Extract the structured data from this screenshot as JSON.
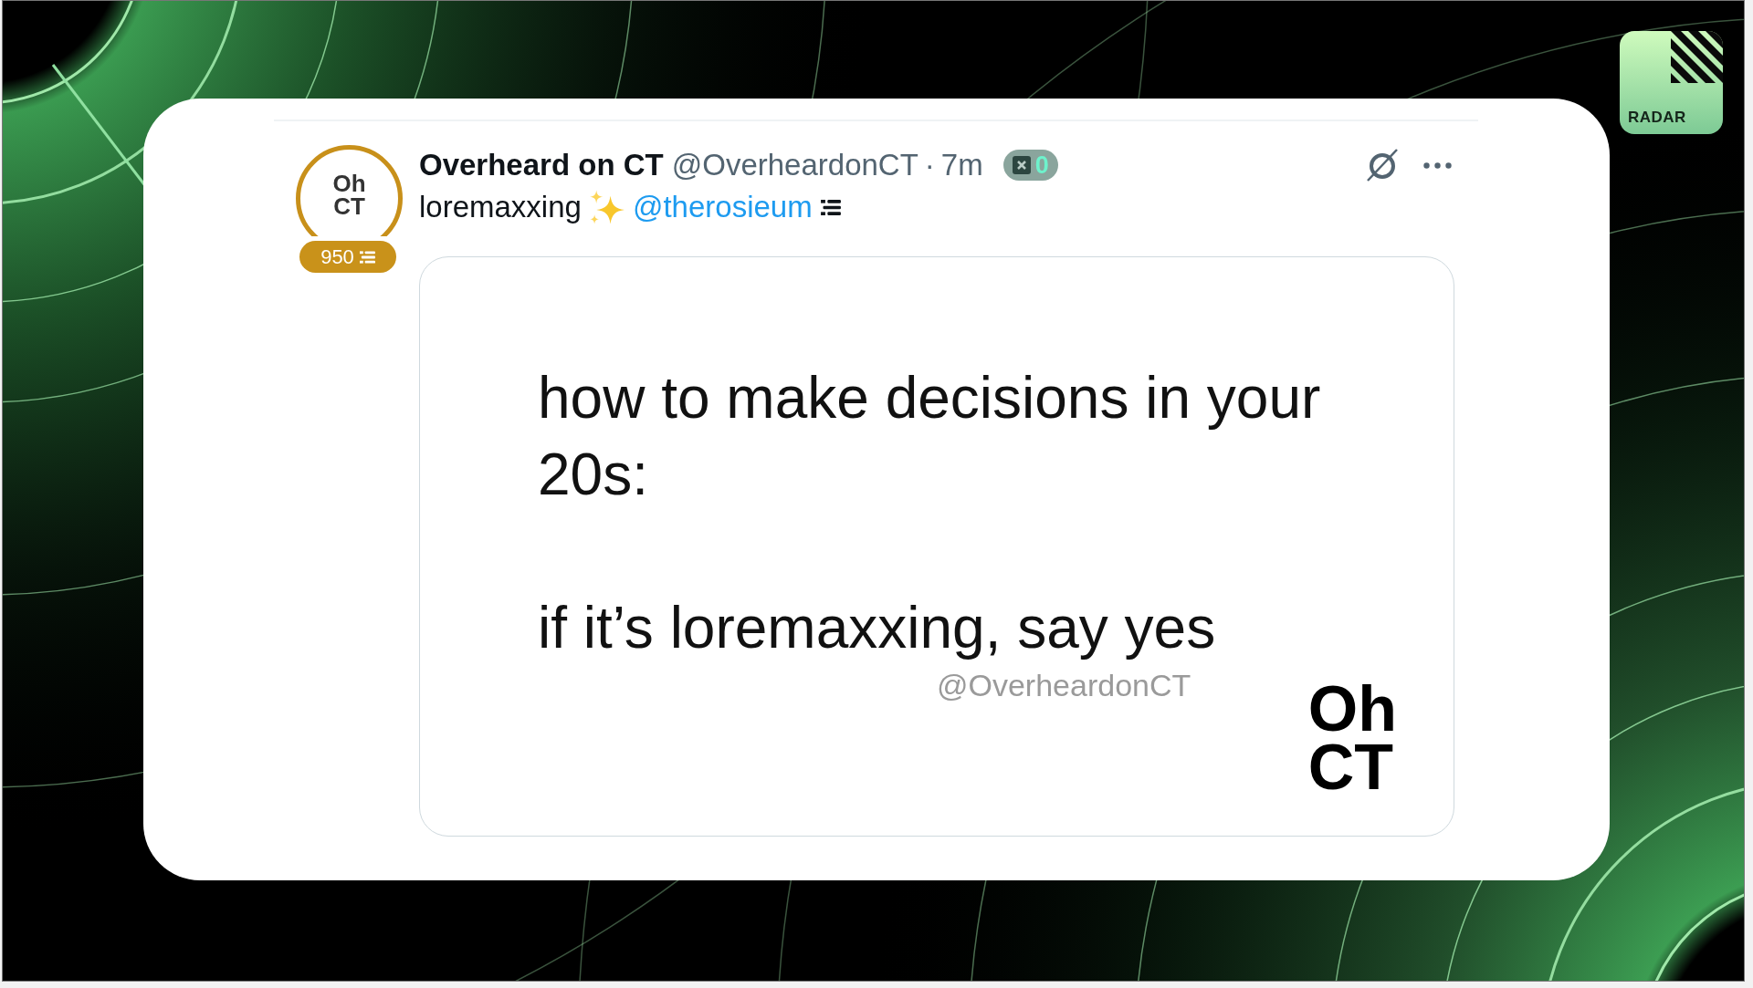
{
  "logo": {
    "label": "RADAR"
  },
  "post": {
    "avatar": {
      "text": "Oh CT",
      "score": "950"
    },
    "author": {
      "name": "Overheard on CT",
      "handle": "@OverheardonCT"
    },
    "separator": "·",
    "time": "7m",
    "counter": "0",
    "body": {
      "text": "loremaxxing",
      "mention": "@therosieum"
    },
    "media": {
      "lines": [
        "how to make decisions in your 20s:",
        "if it’s loremaxxing, say yes"
      ],
      "watermark": "@OverheardonCT",
      "logo_text": "Oh CT"
    }
  }
}
